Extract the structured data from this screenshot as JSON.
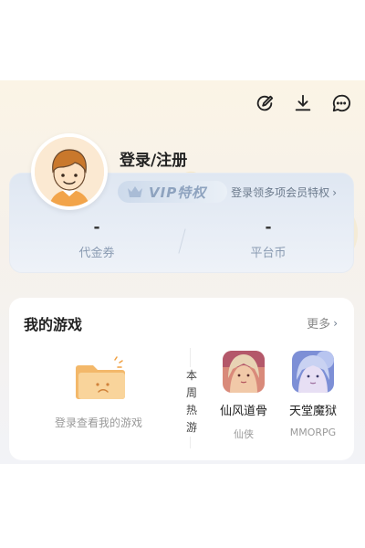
{
  "header": {
    "login_label": "登录/注册",
    "icons": [
      "edit-icon",
      "download-icon",
      "message-icon"
    ]
  },
  "vip": {
    "badge_text": "VIP特权",
    "promo_link": "登录领多项会员特权",
    "stats": [
      {
        "value": "-",
        "label": "代金券"
      },
      {
        "value": "-",
        "label": "平台币"
      }
    ]
  },
  "my_games": {
    "title": "我的游戏",
    "more_label": "更多",
    "empty_text": "登录查看我的游戏",
    "weekly_hot_label": "本周热游",
    "games": [
      {
        "name": "仙风道骨",
        "tag": "仙侠"
      },
      {
        "name": "天堂魔狱",
        "tag": "MMORPG"
      }
    ]
  },
  "colors": {
    "vip_text": "#8ea3bf",
    "accent_orange": "#f0a042",
    "muted_text": "#999999"
  }
}
